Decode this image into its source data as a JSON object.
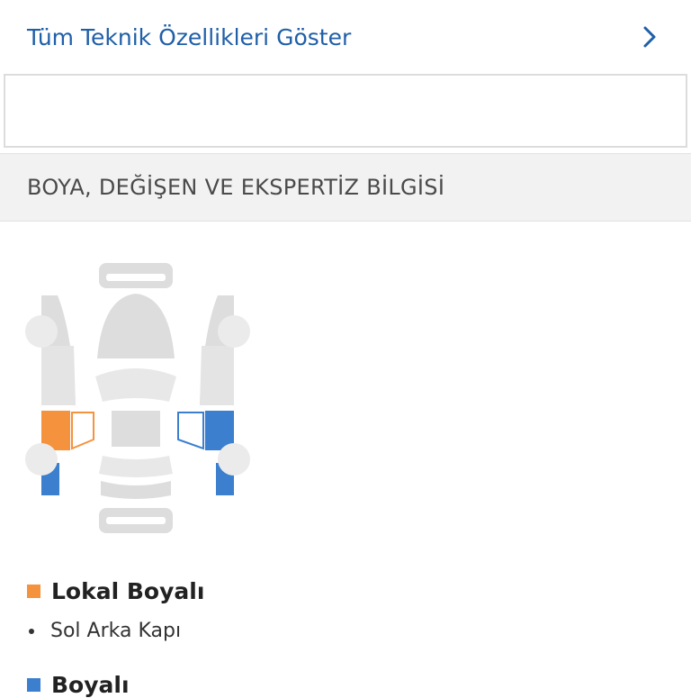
{
  "top_link": {
    "label": "Tüm Teknik Özellikleri Göster",
    "icon": "chevron-right-icon"
  },
  "section": {
    "title": "BOYA, DEĞİŞEN VE EKSPERTİZ BİLGİSİ"
  },
  "colors": {
    "link": "#1f5fa8",
    "local_painted": "#f5923e",
    "painted": "#3b7fce",
    "car_gray": "#dddddd"
  },
  "legend": {
    "local_painted": {
      "label": "Lokal Boyalı",
      "items": [
        "Sol Arka Kapı"
      ]
    },
    "painted": {
      "label": "Boyalı"
    }
  }
}
